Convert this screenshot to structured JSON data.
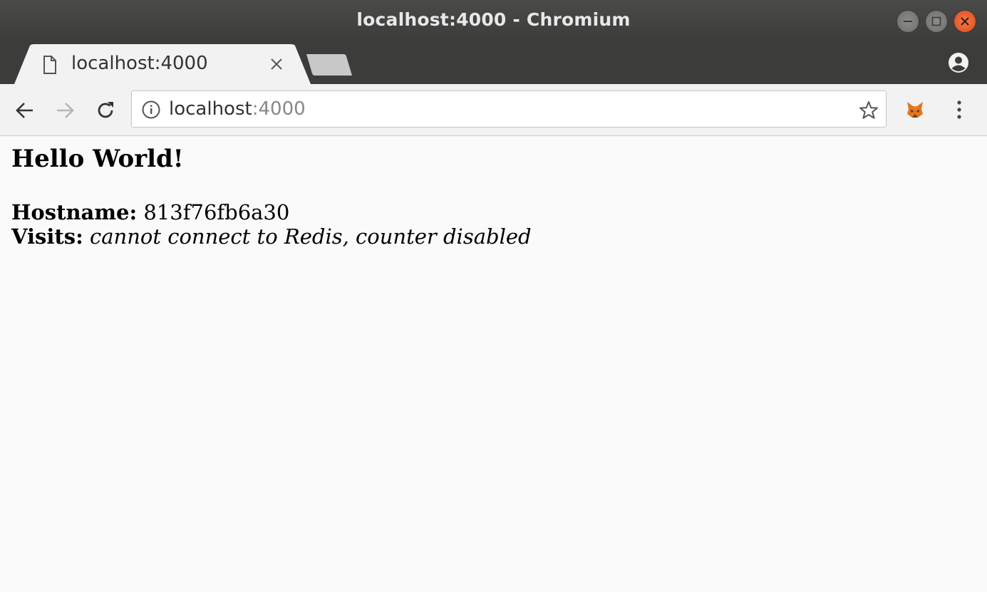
{
  "window": {
    "title": "localhost:4000 - Chromium"
  },
  "tabs": [
    {
      "label": "localhost:4000",
      "icon": "page-icon",
      "active": true
    }
  ],
  "toolbar": {
    "url_host": "localhost",
    "url_port": ":4000"
  },
  "page": {
    "heading": "Hello World!",
    "hostname_label": "Hostname:",
    "hostname_value": "813f76fb6a30",
    "visits_label": "Visits:",
    "visits_value": "cannot connect to Redis, counter disabled"
  },
  "colors": {
    "titlebar": "#3c3c3a",
    "close_button": "#df4b16",
    "toolbar": "#f2f2f2",
    "page_background": "#fafafa"
  }
}
